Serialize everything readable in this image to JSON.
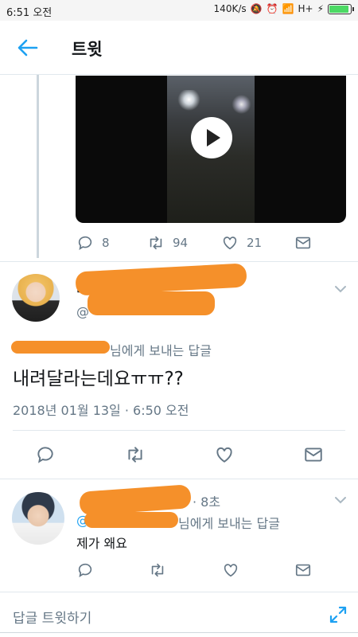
{
  "status_bar": {
    "time": "6:51 오전",
    "network_speed": "140K/s",
    "signal_label": "H+",
    "battery_level": 0.85
  },
  "app_bar": {
    "title": "트윗",
    "back_icon": "arrow-left-icon"
  },
  "prev_tweet": {
    "replies": "8",
    "retweets": "94",
    "likes": "21"
  },
  "main_tweet": {
    "handle_prefix": "@",
    "name_prefix": "[",
    "reply_context": "님에게 보내는 답글",
    "text": "내려달라는데요ㅠㅠ??",
    "timestamp": "2018년 01월 13일 · 6:50 오전"
  },
  "reply_tweet": {
    "time_ago": "· 8초",
    "handle_prefix": "@",
    "reply_context": "님에게 보내는 답글",
    "text": "제가 왜요"
  },
  "compose": {
    "placeholder": "답글 트윗하기"
  },
  "colors": {
    "accent": "#1da1f2",
    "muted": "#657786",
    "redaction": "#f5902a"
  }
}
